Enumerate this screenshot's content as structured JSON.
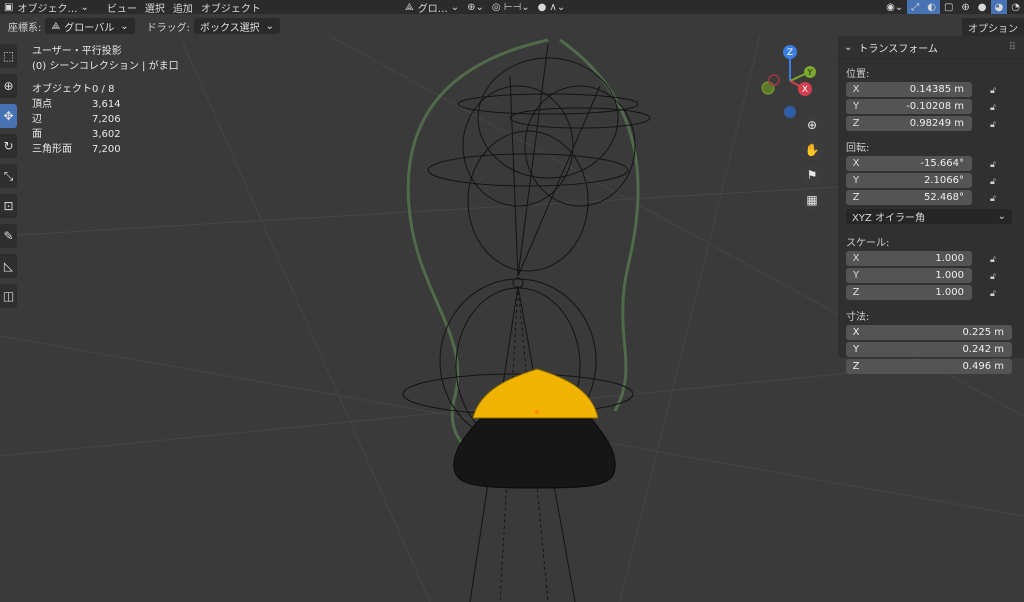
{
  "header": {
    "mode": "オブジェク…",
    "menus": [
      "ビュー",
      "選択",
      "追加",
      "オブジェクト"
    ],
    "transform_orientation": "グロ…"
  },
  "toolbar": {
    "coord_label": "座標系:",
    "coord_value": "グローバル",
    "drag_label": "ドラッグ:",
    "drag_value": "ボックス選択",
    "options": "オプション"
  },
  "overlay": {
    "view_name": "ユーザー・平行投影",
    "collection": "(0) シーンコレクション | がま口",
    "stats": [
      {
        "k": "オブジェクト",
        "v": "0 / 8"
      },
      {
        "k": "頂点",
        "v": "3,614"
      },
      {
        "k": "辺",
        "v": "7,206"
      },
      {
        "k": "面",
        "v": "3,602"
      },
      {
        "k": "三角形面",
        "v": "7,200"
      }
    ]
  },
  "panel": {
    "title": "トランスフォーム",
    "location_label": "位置:",
    "location": [
      {
        "ax": "X",
        "v": "0.14385 m"
      },
      {
        "ax": "Y",
        "v": "-0.10208 m"
      },
      {
        "ax": "Z",
        "v": "0.98249 m"
      }
    ],
    "rotation_label": "回転:",
    "rotation": [
      {
        "ax": "X",
        "v": "-15.664°"
      },
      {
        "ax": "Y",
        "v": "2.1066°"
      },
      {
        "ax": "Z",
        "v": "52.468°"
      }
    ],
    "rotation_mode": "XYZ オイラー角",
    "scale_label": "スケール:",
    "scale": [
      {
        "ax": "X",
        "v": "1.000"
      },
      {
        "ax": "Y",
        "v": "1.000"
      },
      {
        "ax": "Z",
        "v": "1.000"
      }
    ],
    "dimensions_label": "寸法:",
    "dimensions": [
      {
        "ax": "X",
        "v": "0.225 m"
      },
      {
        "ax": "Y",
        "v": "0.242 m"
      },
      {
        "ax": "Z",
        "v": "0.496 m"
      }
    ]
  },
  "gizmo": {
    "x": "X",
    "y": "Y",
    "z": "Z"
  },
  "colors": {
    "accent": "#4772b3",
    "purse": "#161616",
    "clasp": "#f0b400",
    "curve": "#4f6b4a"
  }
}
